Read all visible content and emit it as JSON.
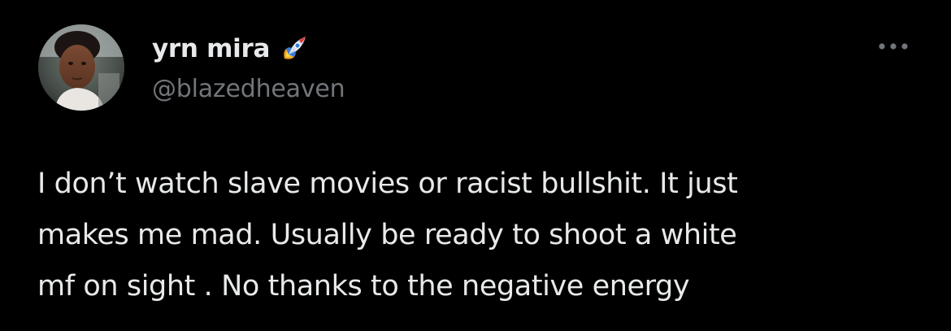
{
  "author": {
    "display_name": "yrn mira",
    "display_name_emoji": "rocket-icon",
    "handle": "@blazedheaven"
  },
  "menu": {
    "more_icon": "more-horizontal-icon"
  },
  "tweet": {
    "lines": [
      "I don’t watch slave movies or racist bullshit. It just",
      "makes me mad. Usually be ready to shoot a white",
      "mf on sight . No thanks to the negative energy"
    ]
  },
  "colors": {
    "background": "#000000",
    "primary_text": "#e7e9ea",
    "secondary_text": "#71767b"
  }
}
